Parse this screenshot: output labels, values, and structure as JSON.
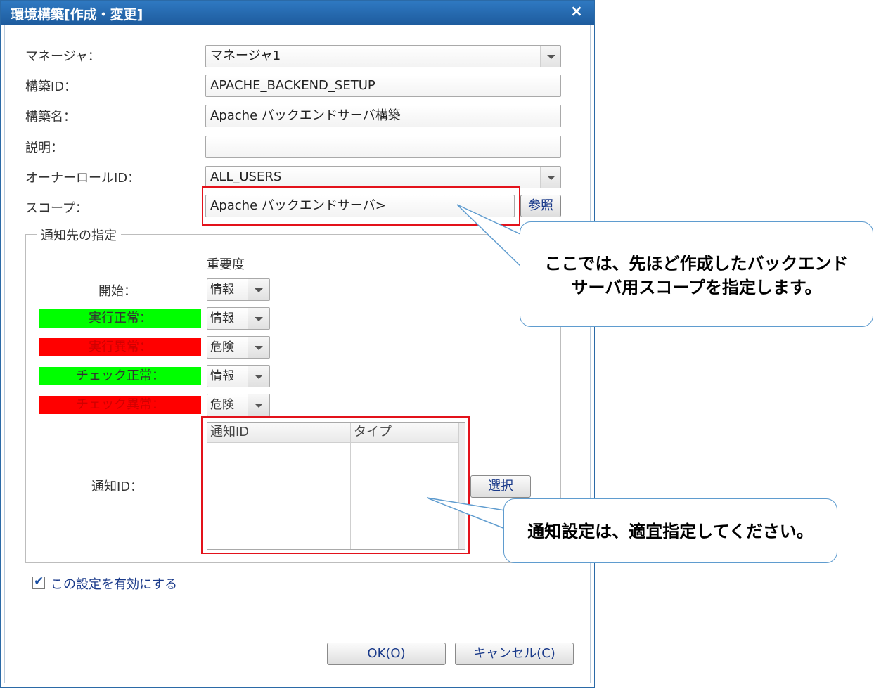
{
  "dialog": {
    "title": "環境構築[作成・変更]",
    "close_glyph": "×"
  },
  "form": {
    "manager_label": "マネージャ：",
    "manager_value": "マネージャ1",
    "id_label": "構築ID：",
    "id_value": "APACHE_BACKEND_SETUP",
    "name_label": "構築名：",
    "name_value": "Apache バックエンドサーバ構築",
    "desc_label": "説明：",
    "desc_value": "",
    "owner_label": "オーナーロールID：",
    "owner_value": "ALL_USERS",
    "scope_label": "スコープ：",
    "scope_value": "Apache バックエンドサーバ>",
    "scope_button": "参照"
  },
  "notify": {
    "legend": "通知先の指定",
    "severity_header": "重要度",
    "rows": [
      {
        "label": "開始：",
        "severity": "情報",
        "color": ""
      },
      {
        "label": "実行正常：",
        "severity": "情報",
        "color": "#00ff00"
      },
      {
        "label": "実行異常：",
        "severity": "危険",
        "color": "#ff0000"
      },
      {
        "label": "チェック正常：",
        "severity": "情報",
        "color": "#00ff00"
      },
      {
        "label": "チェック異常：",
        "severity": "危険",
        "color": "#ff0000"
      }
    ],
    "id_label": "通知ID：",
    "columns": [
      "通知ID",
      "タイプ"
    ],
    "select_button": "選択"
  },
  "enable_checkbox": {
    "label": "この設定を有効にする",
    "checked": true
  },
  "footer": {
    "ok": "OK(O)",
    "cancel": "キャンセル(C)"
  },
  "callouts": {
    "scope_note_line1": "ここでは、先ほど作成したバックエンド",
    "scope_note_line2": "サーバ用スコープを指定します。",
    "notify_note": "通知設定は、適宜指定してください。"
  },
  "colors": {
    "title_bar": "#1e5c9e",
    "highlight_red": "#e3121b",
    "callout_border": "#5f9ccf",
    "status_normal": "#00ff00",
    "status_error": "#ff0000"
  }
}
